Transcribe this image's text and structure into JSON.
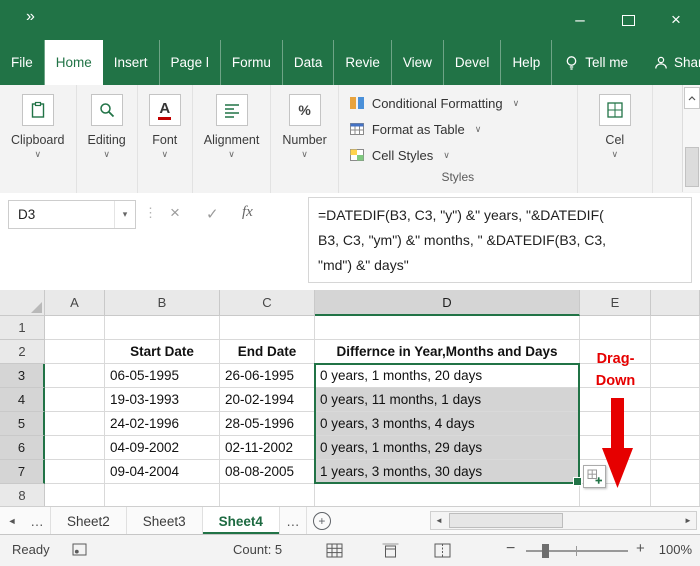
{
  "colors": {
    "brand_green": "#217346",
    "annotation_red": "#e60000",
    "selection_fill": "#d4d4d4"
  },
  "icons": {
    "qat_chevron": "»",
    "minimize": "–",
    "close": "×",
    "dropdown_chevron": "∨",
    "namebox_dropdown": "▾",
    "separator_dots": "⋮",
    "cancel": "×",
    "enter": "✓",
    "fx": "fx",
    "font_icon": "A",
    "number_icon": "%",
    "nav_left": "◄",
    "nav_right": "►",
    "overflow": "…",
    "add_sheet": "+",
    "zoom_out": "−",
    "zoom_in": "+",
    "scroll_up": "▲"
  },
  "ribbon": {
    "tabs": [
      "File",
      "Home",
      "Insert",
      "Page l",
      "Formu",
      "Data",
      "Revie",
      "View",
      "Devel",
      "Help"
    ],
    "active_tab": "Home",
    "tell_me": "Tell me",
    "share": "Share",
    "collapsed_groups": [
      "Clipboard",
      "Editing",
      "Font",
      "Alignment",
      "Number"
    ],
    "styles_group": {
      "label": "Styles",
      "items": [
        "Conditional Formatting",
        "Format as Table",
        "Cell Styles"
      ]
    },
    "cells_group_truncated": "Cel"
  },
  "formula_bar": {
    "name_box": "D3",
    "formula_lines": [
      "=DATEDIF(B3, C3, \"y\") &\" years, \"&DATEDIF(",
      "B3, C3, \"ym\") &\" months, \" &DATEDIF(B3, C3,",
      "\"md\") &\" days\""
    ]
  },
  "grid": {
    "column_letters": [
      "A",
      "B",
      "C",
      "D",
      "E"
    ],
    "row_numbers": [
      1,
      2,
      3,
      4,
      5,
      6,
      7,
      8
    ],
    "cells": {
      "B2": "Start Date",
      "C2": "End Date",
      "D2": "Differnce in Year,Months and Days",
      "B3": "06-05-1995",
      "C3": "26-06-1995",
      "D3": "0 years, 1 months, 20 days",
      "B4": "19-03-1993",
      "C4": "20-02-1994",
      "D4": "0 years, 11 months, 1 days",
      "B5": "24-02-1996",
      "C5": "28-05-1996",
      "D5": "0 years, 3 months, 4 days",
      "B6": "04-09-2002",
      "C6": "02-11-2002",
      "D6": "0 years, 1 months, 29 days",
      "B7": "09-04-2004",
      "C7": "08-08-2005",
      "D7": "1 years, 3 months, 30 days"
    },
    "selection": {
      "active_cell": "D3",
      "range": "D3:D7"
    }
  },
  "annotation": {
    "line1": "Drag-",
    "line2": "Down"
  },
  "sheet_tabs": {
    "items": [
      "Sheet2",
      "Sheet3",
      "Sheet4"
    ],
    "active": "Sheet4"
  },
  "status_bar": {
    "mode": "Ready",
    "count": "Count: 5",
    "zoom_level": "100%"
  }
}
